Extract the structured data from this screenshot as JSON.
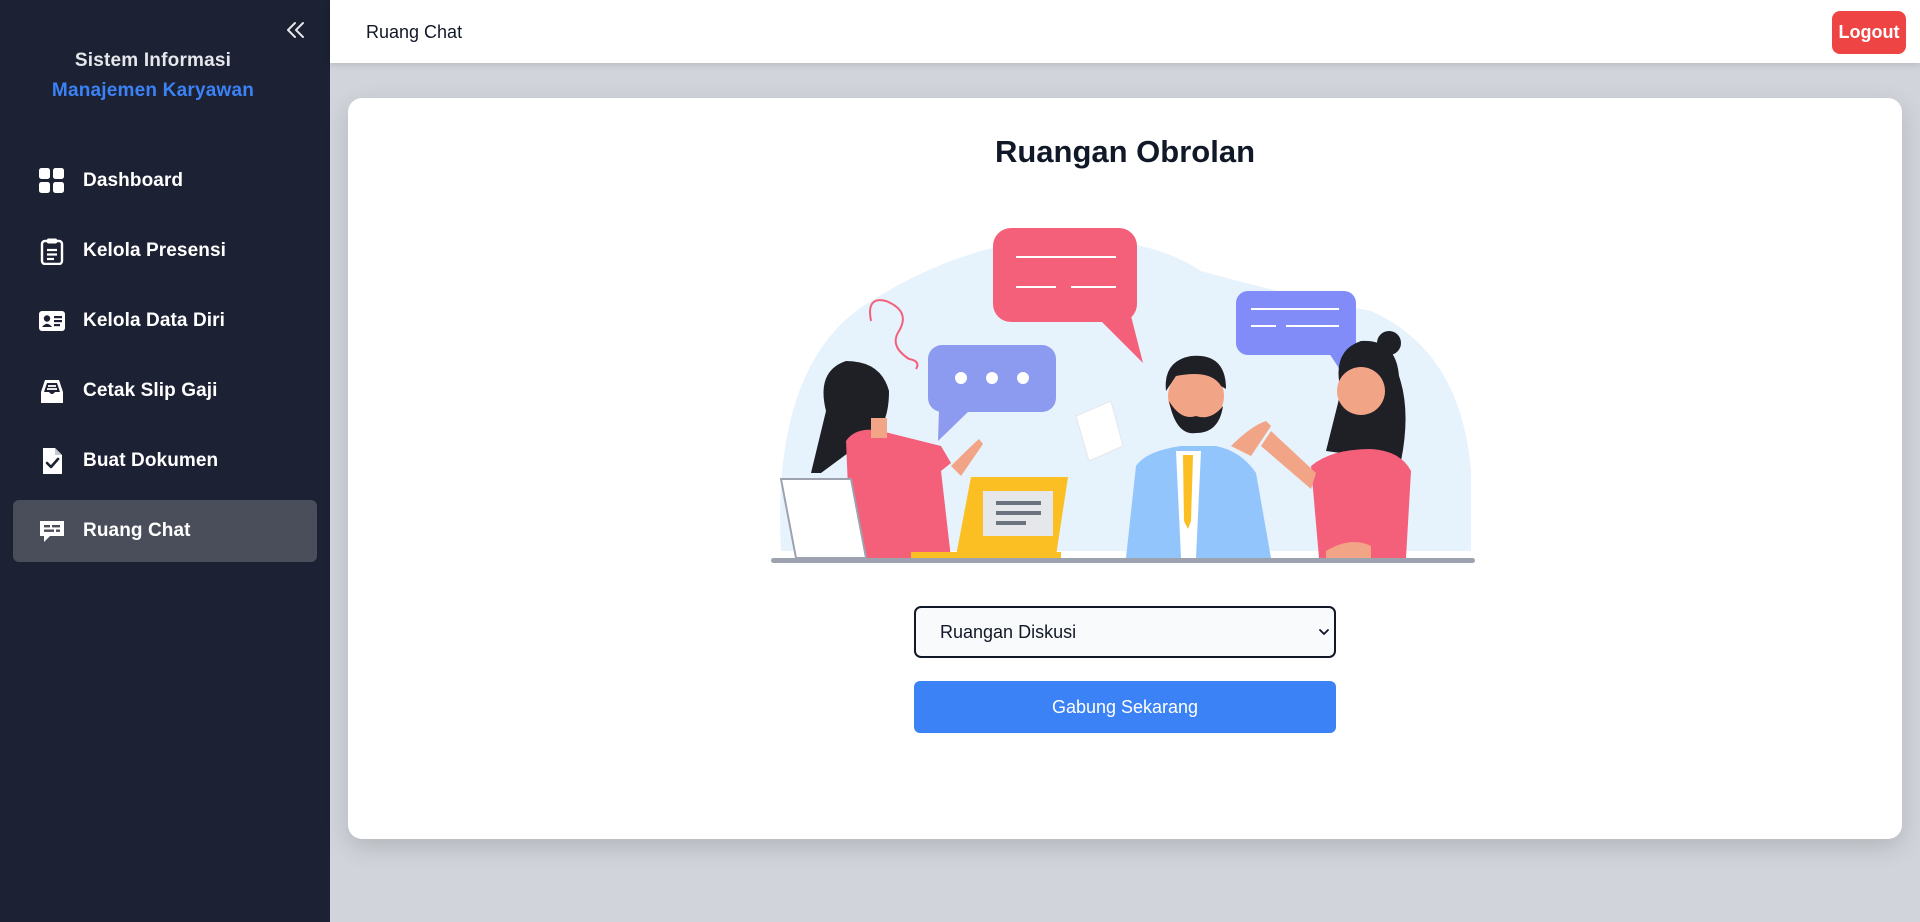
{
  "sidebar": {
    "brand_line1": "Sistem Informasi",
    "brand_line2": "Manajemen Karyawan",
    "items": [
      {
        "label": "Dashboard",
        "icon": "dashboard-grid-icon",
        "active": false
      },
      {
        "label": "Kelola Presensi",
        "icon": "clipboard-icon",
        "active": false
      },
      {
        "label": "Kelola Data Diri",
        "icon": "id-card-icon",
        "active": false
      },
      {
        "label": "Cetak Slip Gaji",
        "icon": "inbox-tray-icon",
        "active": false
      },
      {
        "label": "Buat Dokumen",
        "icon": "document-check-icon",
        "active": false
      },
      {
        "label": "Ruang Chat",
        "icon": "chat-bubble-icon",
        "active": true
      }
    ]
  },
  "header": {
    "title": "Ruang Chat",
    "logout_label": "Logout"
  },
  "main": {
    "title": "Ruangan Obrolan",
    "room_select": {
      "selected": "Ruangan Diskusi",
      "options": [
        "Ruangan Diskusi"
      ]
    },
    "join_label": "Gabung Sekarang"
  },
  "colors": {
    "sidebar_bg": "#1c2133",
    "accent": "#3b82f6",
    "danger": "#ef4444",
    "active_item": "#4a4e5a"
  }
}
